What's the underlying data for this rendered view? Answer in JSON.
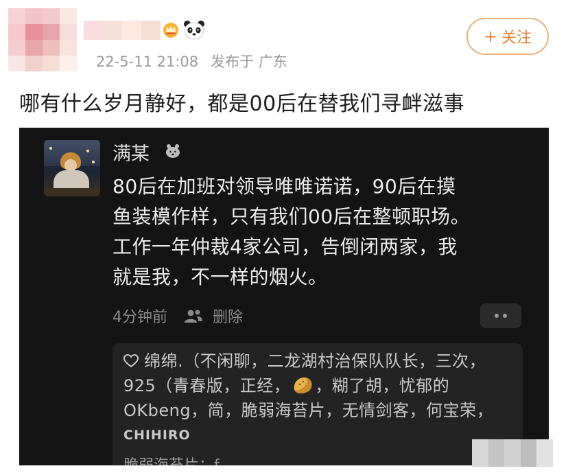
{
  "post": {
    "meta_time": "22-5-11 21:08",
    "meta_source": "发布于 广东",
    "follow_label": "关注",
    "follow_plus": "+",
    "text": "哪有什么岁月静好，都是00后在替我们寻衅滋事"
  },
  "screenshot": {
    "username": "满某",
    "body_lines": [
      "80后在加班对领导唯唯诺诺，90后在摸",
      "鱼装模作样，只有我们00后在整顿职场。",
      "工作一年仲裁4家公司，告倒闭两家，我",
      "就是我，不一样的烟火。"
    ],
    "time_ago": "4分钟前",
    "delete_label": "删除",
    "likes_line1": "绵绵.（不闲聊，二龙湖村治保队队长，三次，",
    "likes_line2a": "925（青春版，正经，",
    "likes_line2b": "，糊了胡，忧郁的",
    "likes_line3": "OKbeng，简，脆弱海苔片，无情剑客，何宝荣，",
    "likes_line4": "CHIHIRO",
    "reply_preview": "脆弱海苔片：f"
  },
  "icons": {
    "vip": "crown-icon",
    "panda": "panda-icon",
    "bear": "bear-icon",
    "people": "people-icon",
    "heart": "heart-icon",
    "cookie": "cookie-emoji-icon",
    "more": "more-dots-icon"
  },
  "colors": {
    "follow_accent": "#e88230",
    "follow_border": "#f0b07a",
    "dark_bg": "#141414",
    "likes_bg": "#232323"
  }
}
